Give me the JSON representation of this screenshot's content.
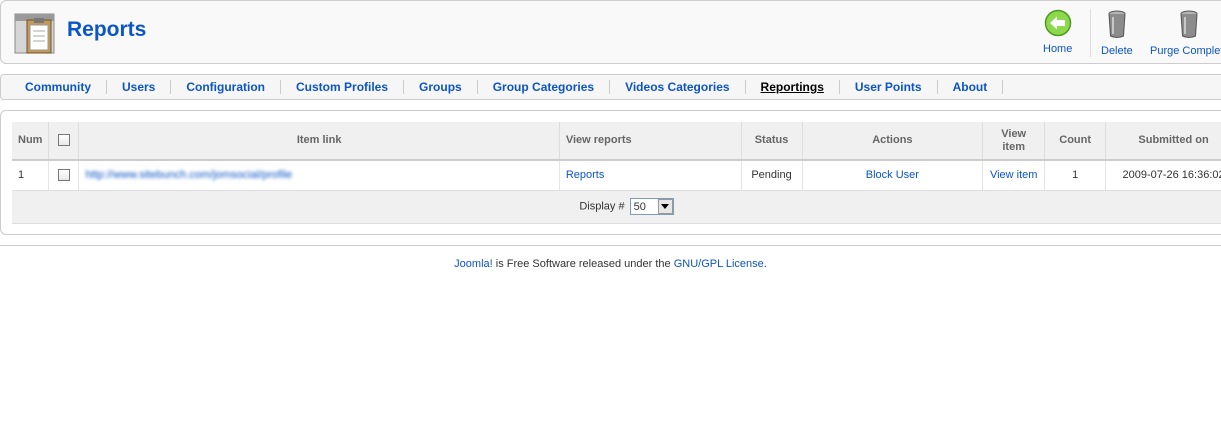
{
  "header": {
    "title": "Reports",
    "icon": "clipboard-icon"
  },
  "toolbar": {
    "home_label": "Home",
    "delete_label": "Delete",
    "purge_label": "Purge Complete",
    "home_icon": "green-back-arrow-icon",
    "trash_icon": "trash-can-icon"
  },
  "submenu": {
    "items": [
      {
        "label": "Community"
      },
      {
        "label": "Users"
      },
      {
        "label": "Configuration"
      },
      {
        "label": "Custom Profiles"
      },
      {
        "label": "Groups"
      },
      {
        "label": "Group Categories"
      },
      {
        "label": "Videos Categories"
      },
      {
        "label": "Reportings",
        "active": true
      },
      {
        "label": "User Points"
      },
      {
        "label": "About"
      }
    ]
  },
  "table": {
    "headers": {
      "num": "Num",
      "item_link": "Item link",
      "view_reports": "View reports",
      "status": "Status",
      "actions": "Actions",
      "view_item_1": "View",
      "view_item_2": "item",
      "count": "Count",
      "submitted_on": "Submitted on"
    },
    "rows": [
      {
        "num": "1",
        "item_link": "http://www.sitebunch.com/jomsocial/profile",
        "view_reports": "Reports",
        "status": "Pending",
        "action": "Block User",
        "view_item": "View item",
        "count": "1",
        "submitted_on": "2009-07-26 16:36:02"
      }
    ],
    "footer": {
      "display_label": "Display #",
      "display_value": "50"
    }
  },
  "footer": {
    "joomla_link": "Joomla!",
    "text": " is Free Software released under the ",
    "license_link": "GNU/GPL License",
    "period": "."
  },
  "colors": {
    "link": "#0b55c4",
    "title": "#0b55c4"
  }
}
